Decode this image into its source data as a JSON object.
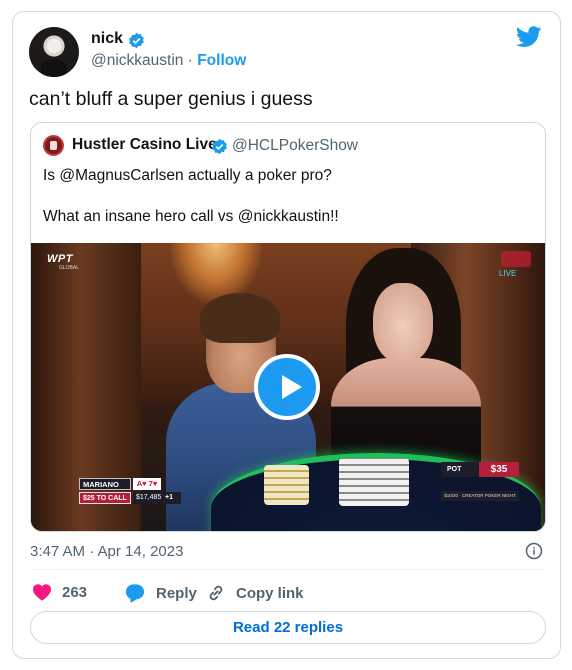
{
  "author": {
    "name": "nick",
    "handle": "@nickkaustin",
    "separator": "·",
    "follow_label": "Follow"
  },
  "tweet": {
    "text": "can’t bluff a super genius i guess",
    "timestamp": "3:47 AM · Apr 14, 2023"
  },
  "quoted_tweet": {
    "name": "Hustler Casino Live",
    "handle": "@HCLPokerShow",
    "line1": "Is @MagnusCarlsen actually a poker pro?",
    "line2": "What an insane hero call vs @nickkaustin!!"
  },
  "video": {
    "wpt_logo": "WPT",
    "wpt_sub": "GLOBAL",
    "hcl_live": "LIVE",
    "player_name": "MARIANO",
    "player_cards": "A♥ 7♥",
    "to_call": "$25 TO CALL",
    "stack": "$17,485",
    "plus": "+1",
    "pot_label": "POT",
    "pot_value": "$35",
    "pot_sub": "$10/20 · CREATOR POKER NIGHT"
  },
  "actions": {
    "likes": "263",
    "reply_label": "Reply",
    "copy_label": "Copy link"
  },
  "footer": {
    "read_replies": "Read 22 replies"
  },
  "colors": {
    "accent": "#1d9bf0",
    "like": "#f91880",
    "text": "#0f1419",
    "secondary": "#536471",
    "link_button": "#006fd6"
  }
}
